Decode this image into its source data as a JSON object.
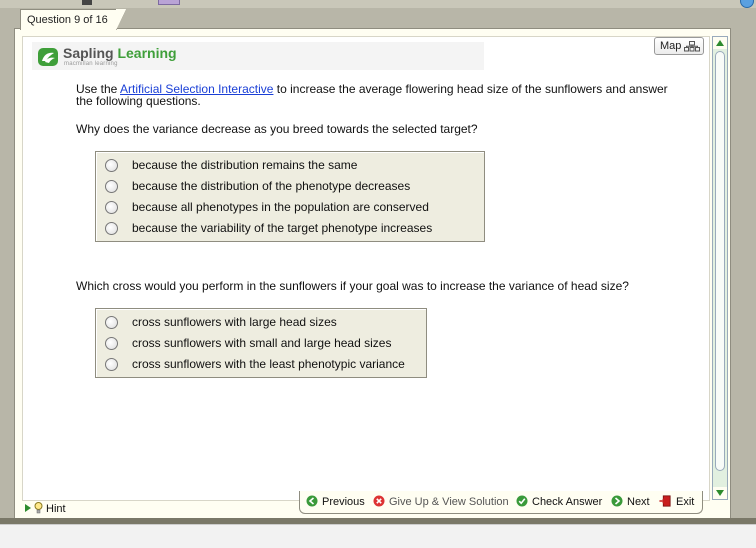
{
  "tab": {
    "label": "Question 9 of 16"
  },
  "brand": {
    "name_part1": "Sapling ",
    "name_part2": "Learning",
    "tagline": "macmillan learning"
  },
  "map_button": {
    "label": "Map"
  },
  "intro": {
    "prefix": "Use the ",
    "link": "Artificial Selection Interactive",
    "suffix": " to increase the average flowering head size of the sunflowers and answer the following questions."
  },
  "question1": {
    "text": "Why does the variance decrease as you breed towards the selected target?",
    "options": [
      "because the distribution remains the same",
      "because the distribution of the phenotype decreases",
      "because all phenotypes in the population are conserved",
      "because the variability of the target phenotype increases"
    ]
  },
  "question2": {
    "text": "Which cross would you perform in the sunflowers if your goal was to increase the variance of head size?",
    "options": [
      "cross sunflowers with large head sizes",
      "cross sunflowers with small and large head sizes",
      "cross sunflowers with the least phenotypic variance"
    ]
  },
  "hint": {
    "label": "Hint"
  },
  "nav": {
    "previous": "Previous",
    "give_up": "Give Up & View Solution",
    "check": "Check Answer",
    "next": "Next",
    "exit": "Exit"
  },
  "colors": {
    "brand_green": "#3f9f3a",
    "link_blue": "#1a3fd6",
    "give_up_red": "#d33",
    "exit_red": "#c81e1e"
  }
}
